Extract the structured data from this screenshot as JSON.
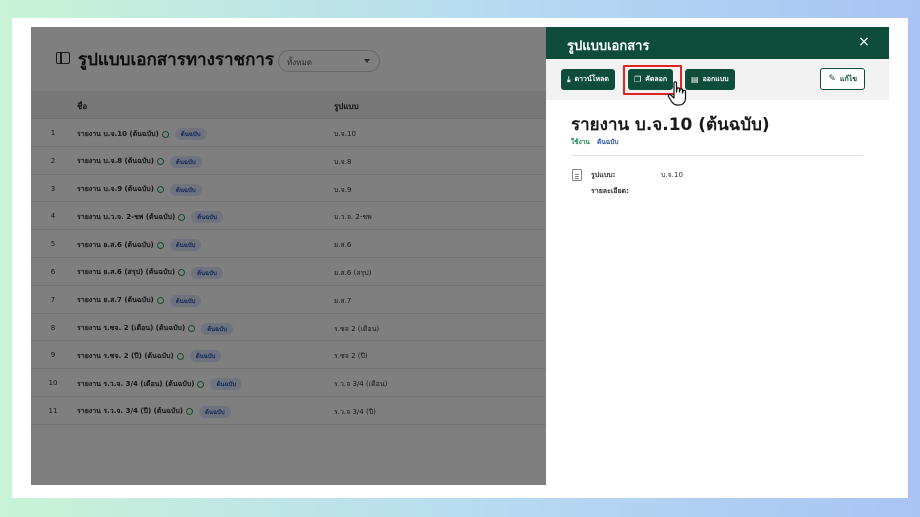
{
  "app": {
    "page_title": "รูปแบบเอกสารทางราชการ",
    "filter_value": "ทั้งหมด",
    "columns": {
      "name": "ชื่อ",
      "format": "รูปแบบ"
    },
    "rows": [
      {
        "num": "1",
        "name": "รายงาน บ.จ.10 (ต้นฉบับ)",
        "badge": "ต้นฉบับ",
        "format": "บ.จ.10"
      },
      {
        "num": "2",
        "name": "รายงาน บ.จ.8 (ต้นฉบับ)",
        "badge": "ต้นฉบับ",
        "format": "บ.จ.8"
      },
      {
        "num": "3",
        "name": "รายงาน บ.จ.9 (ต้นฉบับ)",
        "badge": "ต้นฉบับ",
        "format": "บ.จ.9"
      },
      {
        "num": "4",
        "name": "รายงาน บ.ว.จ. 2-ชพ (ต้นฉบับ)",
        "badge": "ต้นฉบับ",
        "format": "บ.ว.จ. 2-ชพ"
      },
      {
        "num": "5",
        "name": "รายงาน ย.ส.6 (ต้นฉบับ)",
        "badge": "ต้นฉบับ",
        "format": "ย.ส.6"
      },
      {
        "num": "6",
        "name": "รายงาน ย.ส.6 (สรุป) (ต้นฉบับ)",
        "badge": "ต้นฉบับ",
        "format": "ย.ส.6 (สรุป)"
      },
      {
        "num": "7",
        "name": "รายงาน ย.ส.7 (ต้นฉบับ)",
        "badge": "ต้นฉบับ",
        "format": "ย.ส.7"
      },
      {
        "num": "8",
        "name": "รายงาน ร.ซจ. 2 (เดือน) (ต้นฉบับ)",
        "badge": "ต้นฉบับ",
        "format": "ร.ซจ 2 (เดือน)"
      },
      {
        "num": "9",
        "name": "รายงาน ร.ซจ. 2 (ปี) (ต้นฉบับ)",
        "badge": "ต้นฉบับ",
        "format": "ร.ซจ 2 (ปี)"
      },
      {
        "num": "10",
        "name": "รายงาน ร.ว.จ. 3/4 (เดือน) (ต้นฉบับ)",
        "badge": "ต้นฉบับ",
        "format": "ร.ว.จ 3/4 (เดือน)"
      },
      {
        "num": "11",
        "name": "รายงาน ร.ว.จ. 3/4 (ปี) (ต้นฉบับ)",
        "badge": "ต้นฉบับ",
        "format": "ร.ว.จ 3/4 (ปี)"
      }
    ]
  },
  "panel": {
    "title": "รูปแบบเอกสาร",
    "close_icon": "×",
    "toolbar": {
      "download_label": "ดาวน์โหลด",
      "copy_label": "คัดลอก",
      "design_label": "ออกแบบ",
      "edit_label": "แก้ไข"
    },
    "doc_title": "รายงาน บ.จ.10 (ต้นฉบับ)",
    "status_active": "ใช้งาน",
    "status_original": "ต้นฉบับ",
    "meta": {
      "format_label": "รูปแบบ:",
      "format_value": "บ.จ.10",
      "detail_label": "รายละเอียด:"
    }
  },
  "colors": {
    "primary": "#0d4d3a",
    "highlight": "#e02424",
    "badge_text": "#2b55b8",
    "active_text": "#1e8a4c"
  },
  "icons": [
    "sidebar-toggle-icon",
    "chevron-down-icon",
    "check-circle-icon",
    "close-icon",
    "download-icon",
    "copy-icon",
    "document-icon",
    "edit-icon",
    "hand-cursor-icon"
  ]
}
